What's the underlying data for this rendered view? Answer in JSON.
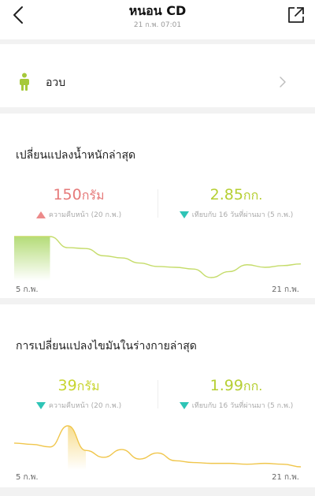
{
  "header": {
    "title": "หนอน CD",
    "subtitle": "21 ก.พ. 07:01"
  },
  "status": {
    "label": "อวบ",
    "icon": "person-icon",
    "icon_color": "#a6c93a"
  },
  "weight_card": {
    "title": "เปลี่ยนแปลงน้ำหนักล่าสุด",
    "left_value": "150",
    "left_unit": "กรัม",
    "left_caption": "ความคืบหน้า (20 ก.พ.)",
    "left_direction": "up",
    "right_value": "2.85",
    "right_unit": "กก.",
    "right_caption": "เทียบกับ 16 วันที่ผ่านมา (5 ก.พ.)",
    "right_direction": "down",
    "axis_start": "5 ก.พ.",
    "axis_end": "21 ก.พ.",
    "line_color": "#c5dc6a",
    "fill_color": "#9bd04b"
  },
  "fat_card": {
    "title": "การเปลี่ยนแปลงไขมันในร่างกายล่าสุด",
    "left_value": "39",
    "left_unit": "กรัม",
    "left_caption": "ความคืบหน้า (20 ก.พ.)",
    "left_direction": "down",
    "right_value": "1.99",
    "right_unit": "กก.",
    "right_caption": "เทียบกับ 16 วันที่ผ่านมา (5 ก.พ.)",
    "right_direction": "down",
    "axis_start": "5 ก.พ.",
    "axis_end": "21 ก.พ.",
    "line_color": "#f0c64c",
    "fill_color": "#f5d26a"
  },
  "chart_data": [
    {
      "type": "area",
      "title": "เปลี่ยนแปลงน้ำหนักล่าสุด",
      "x": [
        "5 ก.พ.",
        "6 ก.พ.",
        "7 ก.พ.",
        "8 ก.พ.",
        "9 ก.พ.",
        "10 ก.พ.",
        "11 ก.พ.",
        "12 ก.พ.",
        "13 ก.พ.",
        "14 ก.พ.",
        "15 ก.พ.",
        "16 ก.พ.",
        "17 ก.พ.",
        "18 ก.พ.",
        "19 ก.พ.",
        "20 ก.พ.",
        "21 ก.พ."
      ],
      "y": [
        100,
        100,
        100,
        74,
        72,
        55,
        50,
        38,
        30,
        28,
        24,
        4,
        18,
        34,
        28,
        32,
        36
      ],
      "highlight_range": [
        0,
        2
      ]
    },
    {
      "type": "area",
      "title": "การเปลี่ยนแปลงไขมันในร่างกายล่าสุด",
      "x": [
        "5 ก.พ.",
        "6 ก.พ.",
        "7 ก.พ.",
        "8 ก.พ.",
        "9 ก.พ.",
        "10 ก.พ.",
        "11 ก.พ.",
        "12 ก.พ.",
        "13 ก.พ.",
        "14 ก.พ.",
        "15 ก.พ.",
        "16 ก.พ.",
        "17 ก.พ.",
        "18 ก.พ.",
        "19 ก.พ.",
        "20 ก.พ.",
        "21 ก.พ."
      ],
      "y": [
        55,
        52,
        46,
        95,
        38,
        22,
        40,
        18,
        32,
        14,
        10,
        8,
        8,
        6,
        8,
        6,
        0
      ],
      "highlight_range": [
        3,
        4
      ]
    }
  ]
}
